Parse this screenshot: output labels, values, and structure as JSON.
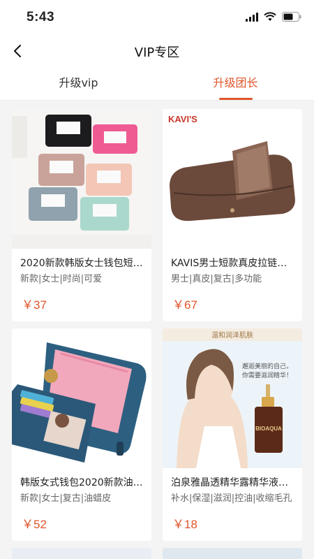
{
  "status_bar": {
    "time": "5:43"
  },
  "nav": {
    "title": "VIP专区"
  },
  "tabs": [
    {
      "label": "升级vip",
      "active": false
    },
    {
      "label": "升级团长",
      "active": true
    }
  ],
  "products": [
    {
      "title": "2020新款韩版女士钱包短…",
      "tags": "新款|女士|时尚|可爱",
      "price": "￥37"
    },
    {
      "title": "KAVIS男士短款真皮拉链…",
      "tags": "男士|真皮|复古|多功能",
      "price": "￥67",
      "brand": "KAVI'S"
    },
    {
      "title": "韩版女式钱包2020新款油…",
      "tags": "新款|女士|复古|油蜡皮",
      "price": "￥52"
    },
    {
      "title": "泊泉雅晶透精华露精华液…",
      "tags": "补水|保湿|滋润|控油|收缩毛孔",
      "price": "￥18",
      "banner": "温和润泽肌肤",
      "slogan_1": "邂逅美丽的自己，",
      "slogan_2": "你需要滋润精华！",
      "bottle_label": "BIOAQUA"
    }
  ],
  "colors": {
    "accent": "#e0562b",
    "background": "#f4f4f4"
  }
}
